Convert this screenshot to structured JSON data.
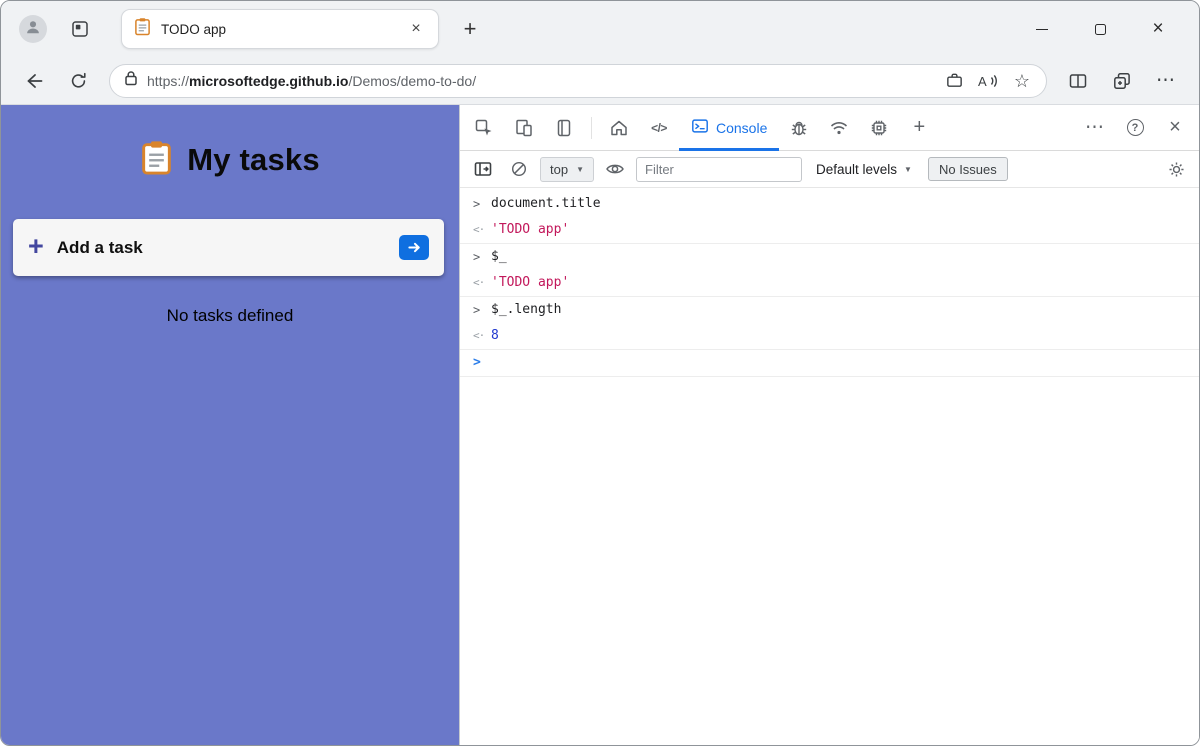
{
  "browser_tab": {
    "title": "TODO app"
  },
  "address_bar": {
    "scheme": "https://",
    "host": "microsoftedge.github.io",
    "path": "/Demos/demo-to-do/"
  },
  "todo_app": {
    "title": "My tasks",
    "add_task_label": "Add a task",
    "empty_message": "No tasks defined"
  },
  "devtools": {
    "console_tab_label": "Console",
    "context_selector": "top",
    "filter_placeholder": "Filter",
    "levels_label": "Default levels",
    "issues_label": "No Issues",
    "console_entries": [
      {
        "type": "command",
        "text": "document.title"
      },
      {
        "type": "result-string",
        "text": "'TODO app'"
      },
      {
        "type": "command",
        "text": "$_"
      },
      {
        "type": "result-string",
        "text": "'TODO app'"
      },
      {
        "type": "command",
        "text": "$_.length"
      },
      {
        "type": "result-number",
        "text": "8"
      }
    ]
  },
  "icons": {
    "prompt_chevron": ">",
    "result_arrow": "<·",
    "new_tab": "+",
    "close": "×",
    "more_ellipsis": "⋯",
    "help": "?",
    "favorites_star": "☆",
    "code_tag": "</>",
    "caret_down": "▼",
    "add_plus": "+"
  },
  "colors": {
    "accent": "#1a73e8",
    "todo-bg": "#6a78c9",
    "string": "#c2185b",
    "number": "#2239cf",
    "chrome-bg": "#f0f2f4"
  }
}
